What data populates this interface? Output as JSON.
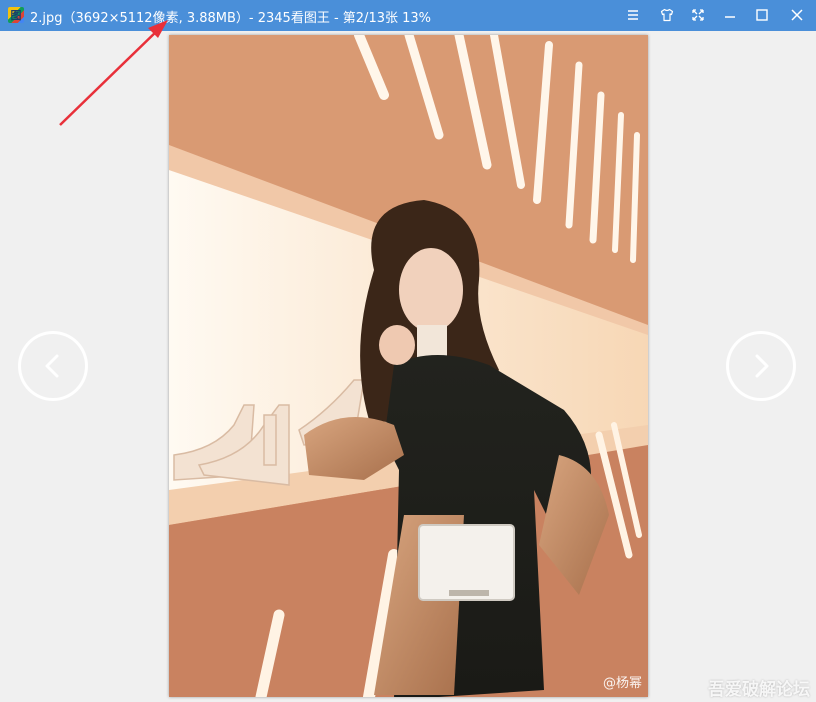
{
  "window": {
    "title": "2.jpg（3692×5112像素, 3.88MB）- 2345看图王 - 第2/13张 13%",
    "app_icon_glyph": "图",
    "controls": [
      "menu-icon",
      "skin-icon",
      "fullscreen-icon",
      "minimize-icon",
      "maximize-icon",
      "close-icon"
    ]
  },
  "viewer": {
    "prev_icon": "chevron-left-icon",
    "next_icon": "chevron-right-icon"
  },
  "photo": {
    "watermark": "@杨幂",
    "site_mark": "吾爱破解论坛"
  },
  "colors": {
    "titlebar": "#4a8fd9",
    "background": "#f0f0f0",
    "annotation_arrow": "#e8303a"
  }
}
